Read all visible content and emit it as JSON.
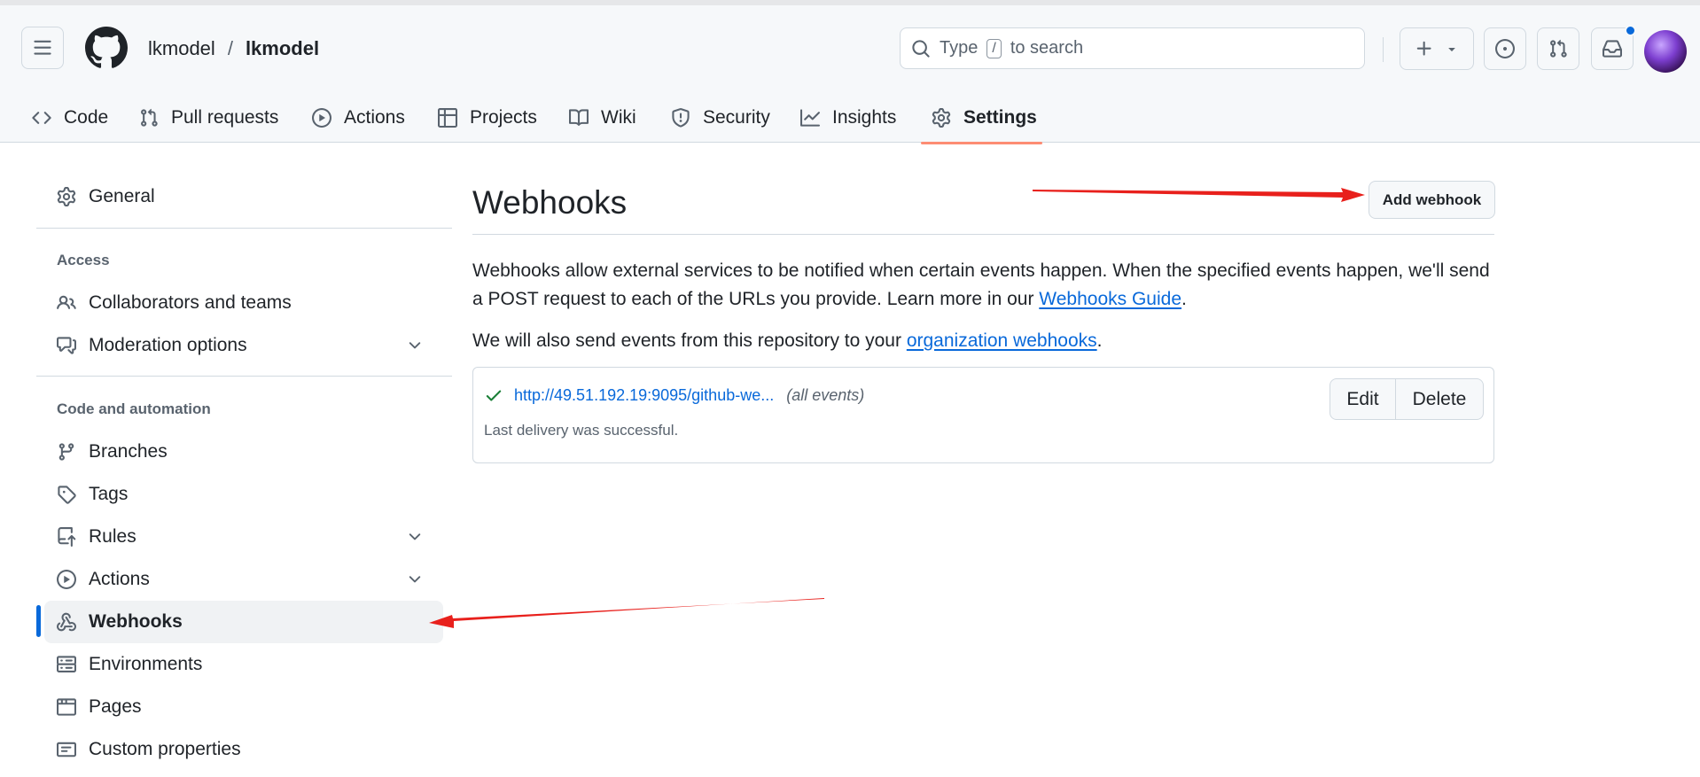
{
  "header": {
    "owner": "lkmodel",
    "separator": "/",
    "repo": "lkmodel",
    "search": {
      "prefix": "Type",
      "key": "/",
      "suffix": "to search"
    }
  },
  "tabs": [
    {
      "label": "Code",
      "icon": "code-icon"
    },
    {
      "label": "Pull requests",
      "icon": "git-pull-request-icon"
    },
    {
      "label": "Actions",
      "icon": "play-icon"
    },
    {
      "label": "Projects",
      "icon": "table-icon"
    },
    {
      "label": "Wiki",
      "icon": "book-icon"
    },
    {
      "label": "Security",
      "icon": "shield-icon"
    },
    {
      "label": "Insights",
      "icon": "graph-icon"
    },
    {
      "label": "Settings",
      "icon": "gear-icon",
      "active": true
    }
  ],
  "sidebar": {
    "general": "General",
    "access_heading": "Access",
    "collaborators": "Collaborators and teams",
    "moderation": "Moderation options",
    "automation_heading": "Code and automation",
    "branches": "Branches",
    "tags": "Tags",
    "rules": "Rules",
    "actions": "Actions",
    "webhooks": "Webhooks",
    "environments": "Environments",
    "pages": "Pages",
    "custom_properties": "Custom properties",
    "active_item": "Webhooks"
  },
  "main": {
    "title": "Webhooks",
    "add_button": "Add webhook",
    "description_part1": "Webhooks allow external services to be notified when certain events happen. When the specified events happen, we'll send a POST request to each of the URLs you provide. Learn more in our ",
    "guide_link": "Webhooks Guide",
    "description_end": ".",
    "org_text": "We will also send events from this repository to your ",
    "org_link": "organization webhooks",
    "org_end": ".",
    "webhook": {
      "url": "http://49.51.192.19:9095/github-we...",
      "events": "(all events)",
      "status": "Last delivery was successful.",
      "edit_label": "Edit",
      "delete_label": "Delete"
    }
  },
  "colors": {
    "accent": "#0969da",
    "success": "#1a7f37",
    "annotation_arrow": "#e8201c",
    "tab_underline": "#fd8c73"
  }
}
